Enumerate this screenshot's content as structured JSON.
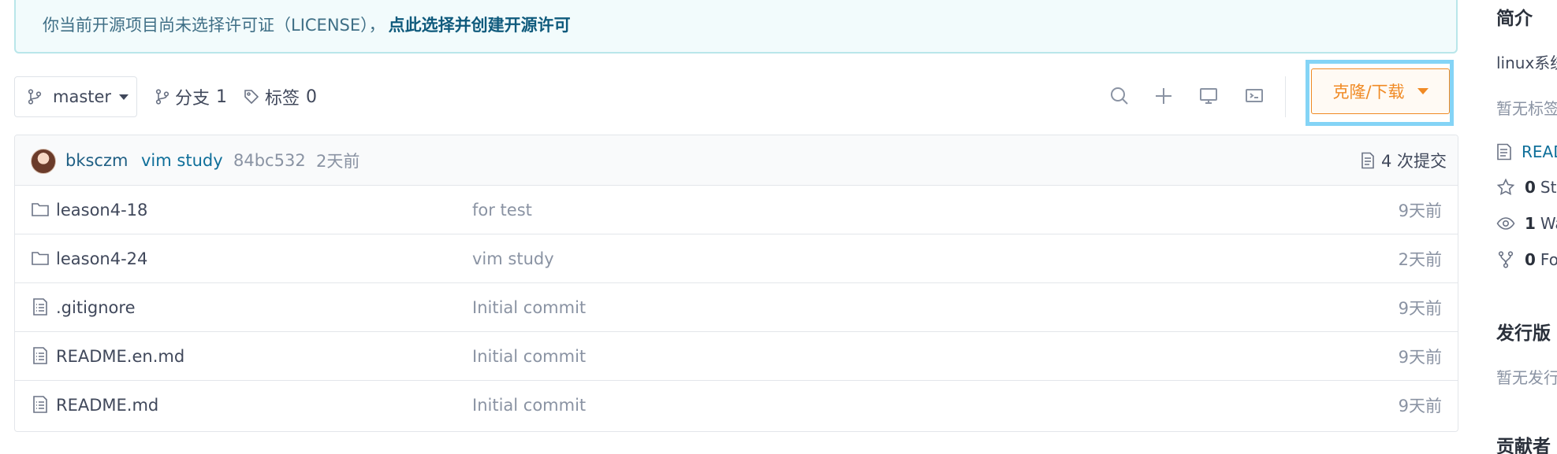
{
  "banner": {
    "text": "你当前开源项目尚未选择许可证（LICENSE），",
    "link": "点此选择并创建开源许可"
  },
  "toolbar": {
    "branch": "master",
    "branches_label": "分支",
    "branches_count": "1",
    "tags_label": "标签",
    "tags_count": "0",
    "clone_label": "克隆/下载"
  },
  "commit": {
    "author": "bksczm",
    "message": "vim study",
    "hash": "84bc532",
    "time": "2天前",
    "count_label": "4 次提交"
  },
  "files": [
    {
      "type": "folder",
      "name": "leason4-18",
      "message": "for test",
      "time": "9天前"
    },
    {
      "type": "folder",
      "name": "leason4-24",
      "message": "vim study",
      "time": "2天前"
    },
    {
      "type": "file",
      "name": ".gitignore",
      "message": "Initial commit",
      "time": "9天前"
    },
    {
      "type": "file",
      "name": "README.en.md",
      "message": "Initial commit",
      "time": "9天前"
    },
    {
      "type": "file",
      "name": "README.md",
      "message": "Initial commit",
      "time": "9天前"
    }
  ],
  "sidebar": {
    "intro_heading": "简介",
    "intro_text": "linux系统",
    "no_tags": "暂无标签",
    "readme": "README",
    "stars_count": "0",
    "stars_label": "Stars",
    "watch_count": "1",
    "watch_label": "Watching",
    "forks_count": "0",
    "forks_label": "Forks",
    "release_heading": "发行版",
    "no_release": "暂无发行版",
    "contributors_heading": "贡献者"
  },
  "colors": {
    "accent_orange": "#f08a24",
    "link_blue": "#0f6f9a",
    "highlight_box": "#84d4f6",
    "banner_bg": "#f2fbfc"
  },
  "icons": {
    "branch": "branch-icon",
    "tag": "tag-icon",
    "search": "search-icon",
    "plus": "plus-icon",
    "monitor": "monitor-icon",
    "terminal": "web-ide-icon",
    "commits": "commit-log-icon",
    "folder": "folder-icon",
    "file": "file-icon",
    "star": "star-icon",
    "eye": "eye-icon",
    "fork": "fork-icon"
  }
}
